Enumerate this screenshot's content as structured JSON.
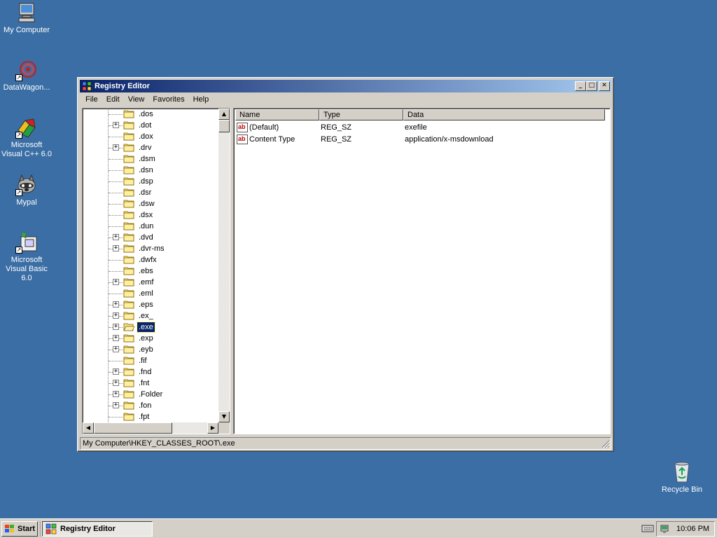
{
  "desktop": {
    "icons": [
      {
        "label": "My Computer"
      },
      {
        "label": "DataWagon..."
      },
      {
        "label": "Microsoft Visual C++ 6.0"
      },
      {
        "label": "Mypal"
      },
      {
        "label": "Microsoft Visual Basic 6.0"
      },
      {
        "label": "Recycle Bin"
      }
    ]
  },
  "window": {
    "title": "Registry Editor",
    "buttons": {
      "minimize": "_",
      "maximize": "□",
      "close": "✕"
    },
    "menu": [
      "File",
      "Edit",
      "View",
      "Favorites",
      "Help"
    ],
    "tree": {
      "items": [
        {
          "label": ".dos",
          "expandable": false
        },
        {
          "label": ".dot",
          "expandable": true
        },
        {
          "label": ".dox",
          "expandable": false
        },
        {
          "label": ".drv",
          "expandable": true
        },
        {
          "label": ".dsm",
          "expandable": false
        },
        {
          "label": ".dsn",
          "expandable": false
        },
        {
          "label": ".dsp",
          "expandable": false
        },
        {
          "label": ".dsr",
          "expandable": false
        },
        {
          "label": ".dsw",
          "expandable": false
        },
        {
          "label": ".dsx",
          "expandable": false
        },
        {
          "label": ".dun",
          "expandable": false
        },
        {
          "label": ".dvd",
          "expandable": true
        },
        {
          "label": ".dvr-ms",
          "expandable": true
        },
        {
          "label": ".dwfx",
          "expandable": false
        },
        {
          "label": ".ebs",
          "expandable": false
        },
        {
          "label": ".emf",
          "expandable": true
        },
        {
          "label": ".eml",
          "expandable": false
        },
        {
          "label": ".eps",
          "expandable": true
        },
        {
          "label": ".ex_",
          "expandable": true
        },
        {
          "label": ".exe",
          "expandable": true,
          "selected": true
        },
        {
          "label": ".exp",
          "expandable": true
        },
        {
          "label": ".eyb",
          "expandable": true
        },
        {
          "label": ".fif",
          "expandable": false
        },
        {
          "label": ".fnd",
          "expandable": true
        },
        {
          "label": ".fnt",
          "expandable": true
        },
        {
          "label": ".Folder",
          "expandable": true
        },
        {
          "label": ".fon",
          "expandable": true
        },
        {
          "label": ".fpt",
          "expandable": false
        }
      ]
    },
    "list": {
      "columns": [
        "Name",
        "Type",
        "Data"
      ],
      "rows": [
        {
          "icon": "ab",
          "name": "(Default)",
          "type": "REG_SZ",
          "data": "exefile"
        },
        {
          "icon": "ab",
          "name": "Content Type",
          "type": "REG_SZ",
          "data": "application/x-msdownload"
        }
      ]
    },
    "status": "My Computer\\HKEY_CLASSES_ROOT\\.exe"
  },
  "taskbar": {
    "start_label": "Start",
    "task_label": "Registry Editor",
    "clock": "10:06 PM"
  },
  "colors": {
    "desktop": "#3a6ea5",
    "title_start": "#0a246a",
    "title_end": "#a6caf0",
    "selection": "#0a246a",
    "face": "#d4d0c8"
  }
}
